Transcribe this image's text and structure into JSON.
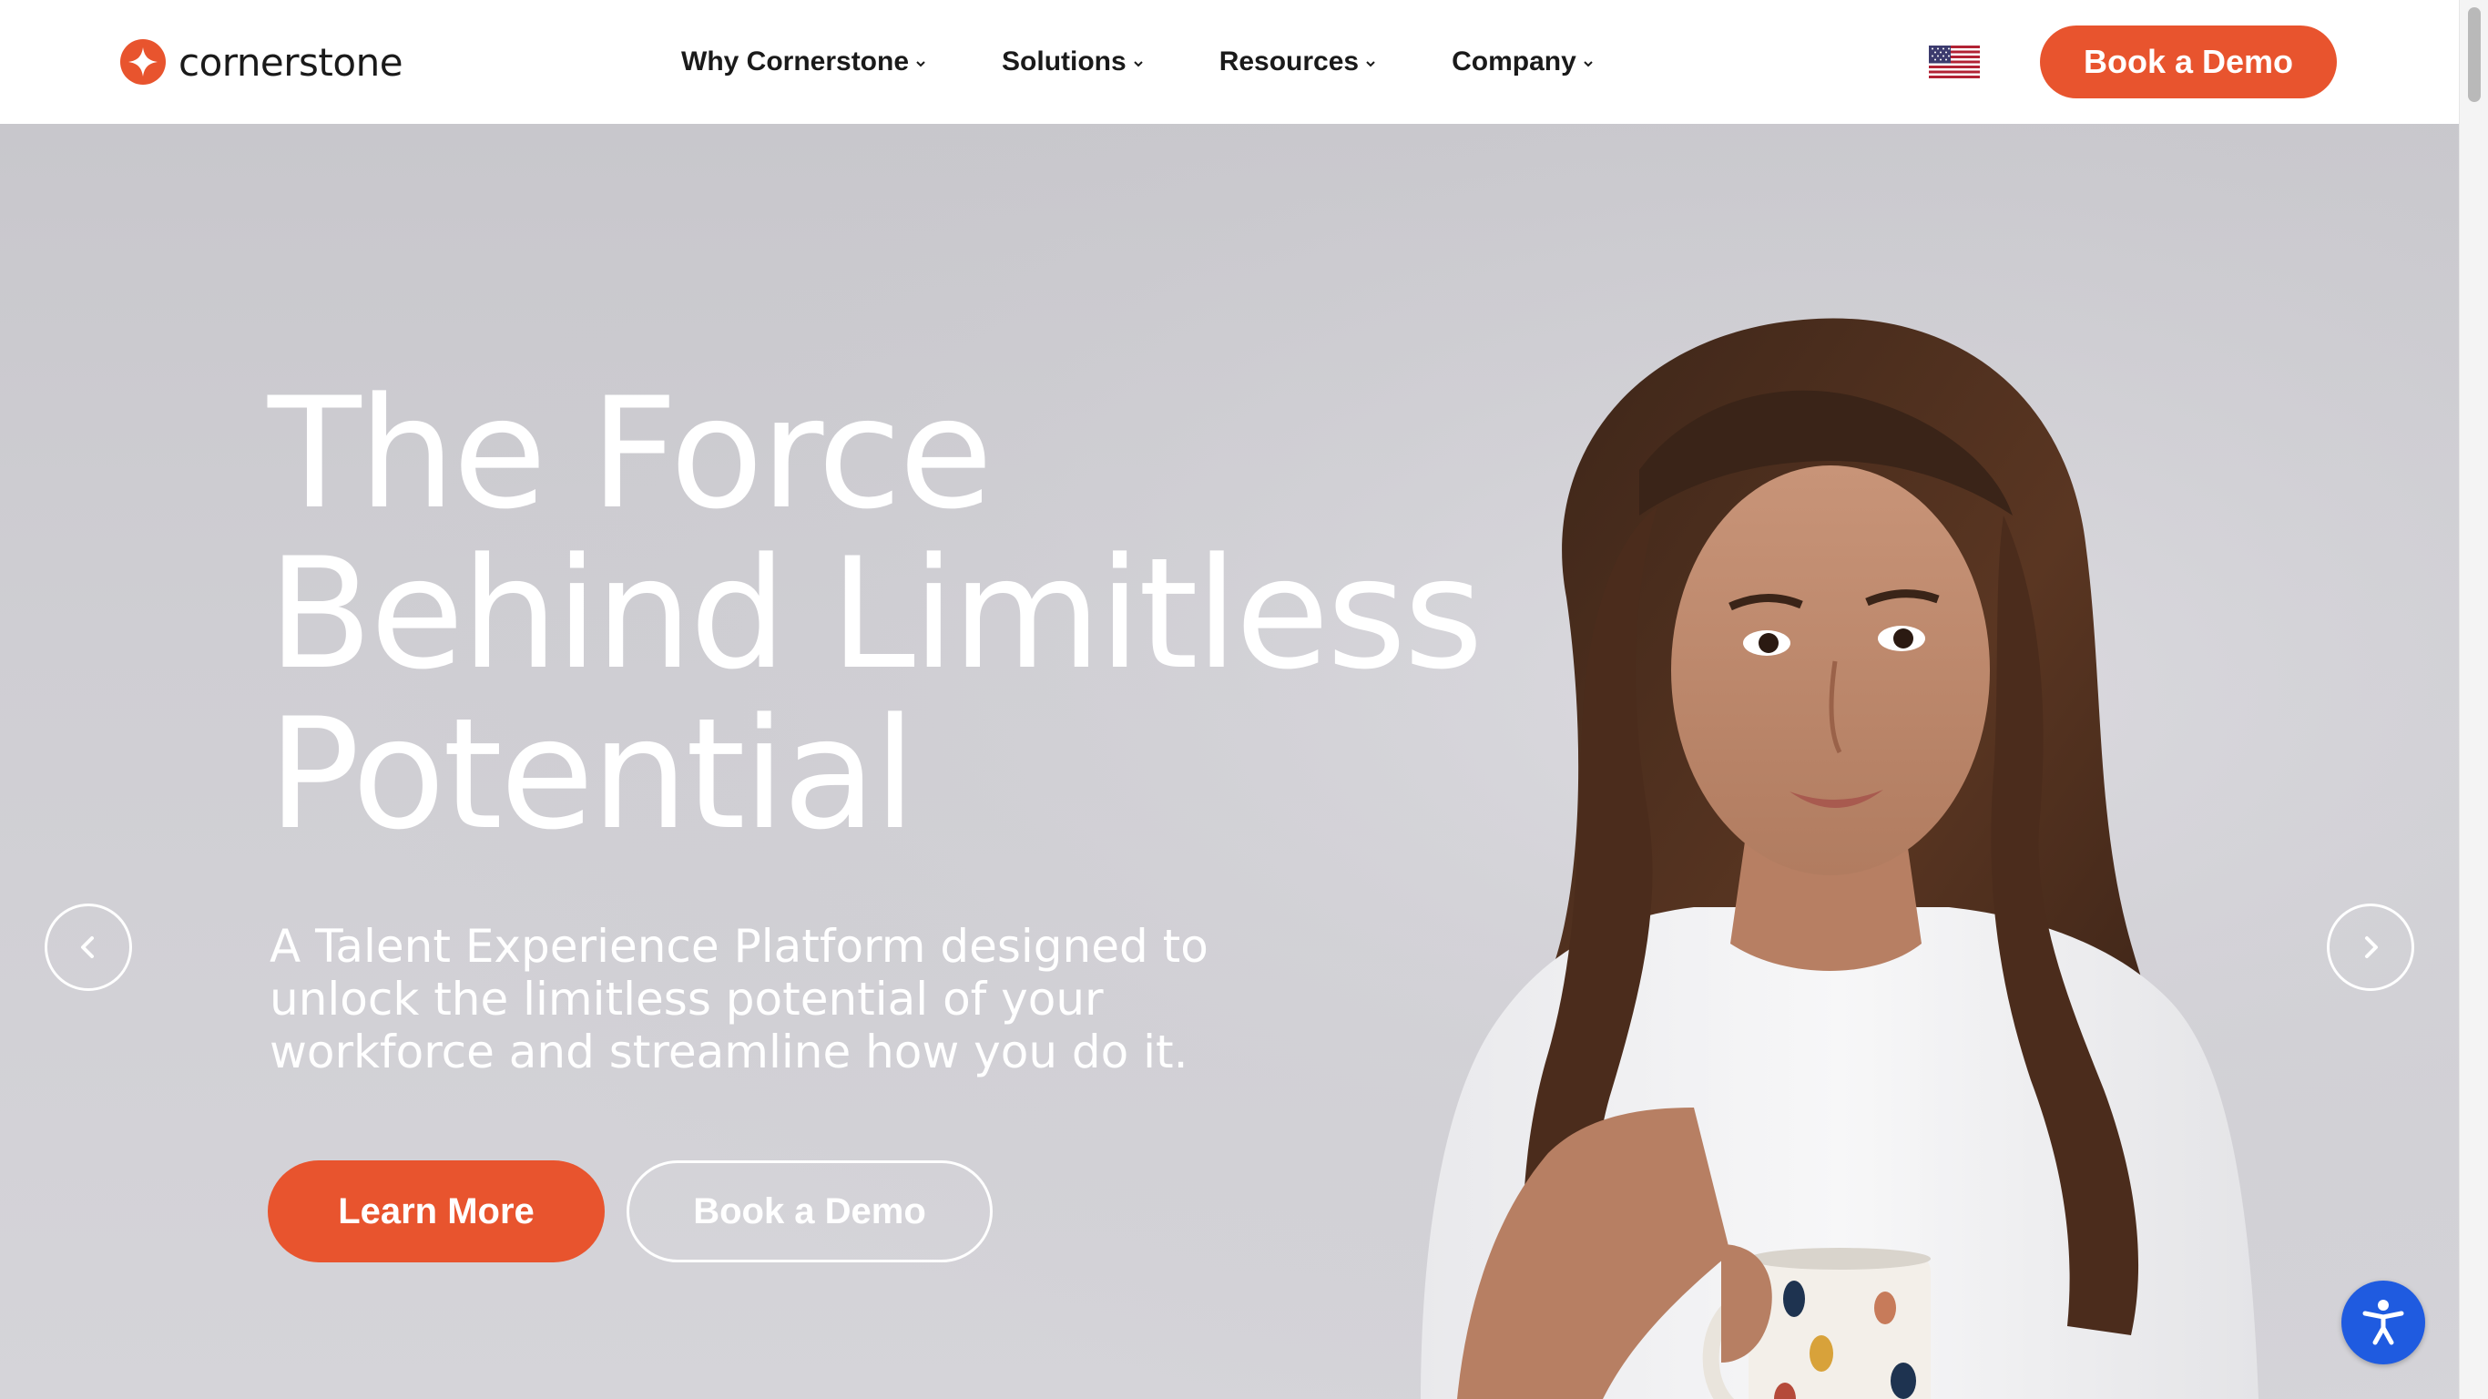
{
  "nav": {
    "logo_text": "cornerstone",
    "items": [
      {
        "label": "Why Cornerstone"
      },
      {
        "label": "Solutions"
      },
      {
        "label": "Resources"
      },
      {
        "label": "Company"
      }
    ],
    "region_flag_icon": "us-flag-icon",
    "cta_label": "Book a Demo"
  },
  "hero": {
    "title_lines": [
      "The Force",
      "Behind Limitless",
      "Potential"
    ],
    "subtitle_lines": [
      "A Talent Experience Platform designed to",
      "unlock the limitless potential of your",
      "workforce and streamline how you do it."
    ],
    "primary_button": "Learn More",
    "secondary_button": "Book a Demo",
    "prev_icon": "chevron-left-icon",
    "next_icon": "chevron-right-icon"
  },
  "accessibility": {
    "icon": "accessibility-icon"
  },
  "colors": {
    "brand_orange": "#e8542e",
    "accessibility_blue": "#1f5be0",
    "hero_background": "#cfced3",
    "text_dark": "#1a1a1a"
  }
}
